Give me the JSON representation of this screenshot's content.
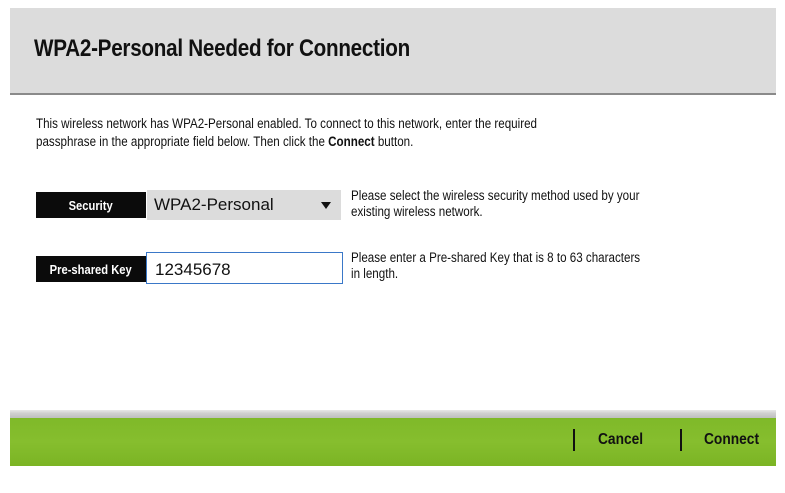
{
  "header": {
    "title": "WPA2-Personal Needed for Connection"
  },
  "intro": {
    "line1": "This wireless network has WPA2-Personal enabled. To connect to this network, enter the required",
    "line2_before": "passphrase in the appropriate field below. Then click the ",
    "line2_bold": "Connect",
    "line2_after": " button."
  },
  "security": {
    "label": "Security",
    "selected": "WPA2-Personal",
    "help_line1": "Please select the wireless security method used by your",
    "help_line2": "existing wireless network."
  },
  "psk": {
    "label": "Pre-shared Key",
    "value": "12345678",
    "help_line1": "Please enter a Pre-shared Key that is 8 to 63 characters",
    "help_line2": "in length."
  },
  "footer": {
    "cancel_label": "Cancel",
    "connect_label": "Connect"
  },
  "colors": {
    "header_bg": "#dcdcdc",
    "label_bg": "#0b0b0b",
    "footer_green": "#82bb2a",
    "input_border": "#3a78c8"
  }
}
